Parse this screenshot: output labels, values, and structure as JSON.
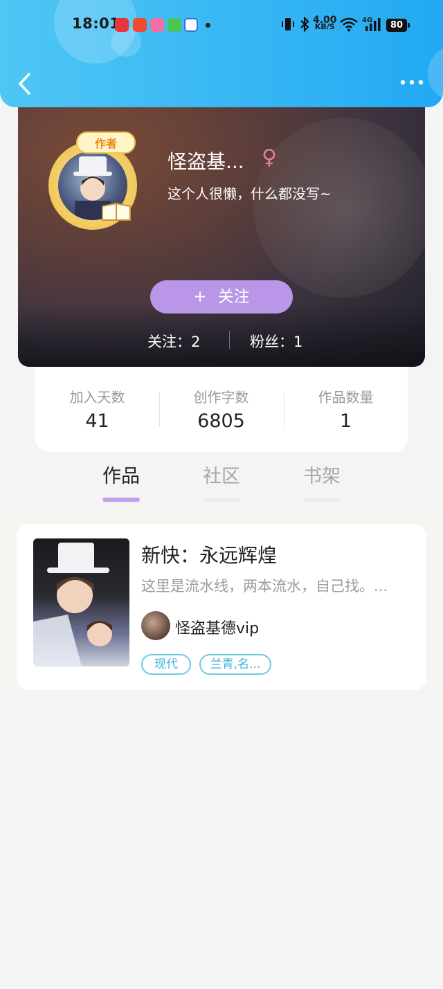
{
  "status_bar": {
    "time": "18:01",
    "net_speed_value": "4.00",
    "net_speed_unit": "KB/S",
    "network_type": "4G",
    "battery": "80"
  },
  "colors": {
    "header_blue": "#3ab8f4",
    "follow_purple": "#b996e8",
    "tag_blue": "#3fb2da",
    "female_pink": "#e67aa0"
  },
  "profile": {
    "badge": "作者",
    "name": "怪盗基...",
    "gender_symbol": "♀",
    "bio": "这个人很懒，什么都没写~",
    "follow_plus": "+",
    "follow_label": "关注",
    "following_text": "关注：2",
    "fans_text": "粉丝：1"
  },
  "stats": [
    {
      "label": "加入天数",
      "value": "41"
    },
    {
      "label": "创作字数",
      "value": "6805"
    },
    {
      "label": "作品数量",
      "value": "1"
    }
  ],
  "tabs": [
    {
      "label": "作品",
      "active": true
    },
    {
      "label": "社区",
      "active": false
    },
    {
      "label": "书架",
      "active": false
    }
  ],
  "works": [
    {
      "title": "新快：永远辉煌",
      "description": "这里是流水线，两本流水，自己找。...",
      "author": "怪盗基德vip",
      "tags": [
        "现代",
        "兰青,名..."
      ]
    }
  ]
}
